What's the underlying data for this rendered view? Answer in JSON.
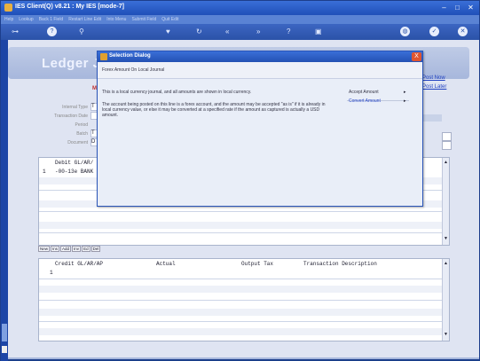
{
  "window": {
    "title": "IES Client(Q) v8.21 : My IES      [mode-7]",
    "buttons": {
      "min": "–",
      "max": "□",
      "close": "✕"
    }
  },
  "menu": [
    "Help",
    "Lookup",
    "Back 1 Field",
    "Restart Line Edit",
    "Into Menu",
    "Submit Field",
    "Quit Edit"
  ],
  "toolbar": {
    "items": [
      {
        "icon": "key-icon",
        "glyph": "⊶"
      },
      {
        "icon": "help-icon",
        "glyph": "?"
      },
      {
        "icon": "search-icon",
        "glyph": "⚲"
      },
      {
        "icon": "heart-icon",
        "glyph": "♥"
      },
      {
        "icon": "refresh-icon",
        "glyph": "↻"
      },
      {
        "icon": "rewind-icon",
        "glyph": "«"
      },
      {
        "icon": "forward-icon",
        "glyph": "»"
      },
      {
        "icon": "question-icon",
        "glyph": "?"
      },
      {
        "icon": "printer-icon",
        "glyph": "▣"
      },
      {
        "icon": "globe-icon",
        "glyph": "◍"
      },
      {
        "icon": "check-icon",
        "glyph": "✓"
      },
      {
        "icon": "cancel-icon",
        "glyph": "✕"
      }
    ]
  },
  "page": {
    "title": "Ledger Jo",
    "links": [
      "Post Now",
      "Post Later"
    ]
  },
  "form": {
    "labels": [
      "Internal Type",
      "Transaction Date",
      "Period",
      "Batch",
      "Document"
    ],
    "inputs": [
      "T",
      "",
      "",
      "T",
      "D"
    ]
  },
  "debit_grid": {
    "header": "Debit GL/AR/",
    "rows": [
      {
        "num": "1",
        "text": "-00-13e BANK"
      }
    ]
  },
  "tabs": [
    "New",
    "Ins",
    "Add",
    "Inv",
    "Ed",
    "Del"
  ],
  "credit_grid": {
    "headers": [
      "Credit GL/AR/AP",
      "Actual",
      "Output Tax",
      "Transaction Description"
    ],
    "rows": [
      {
        "num": "1"
      }
    ]
  },
  "dialog": {
    "title": "Selection Dialog",
    "close": "X",
    "header": "Forex Amount On Local Journal",
    "para1": "This is a local currency journal, and all amounts are shown in local currency.",
    "para2": "The account being posted on this line is a forex account, and the amount may be accepted \"as is\" if it is already in local currency value, or else it may be converted at a specified rate if the amount as captured is actually a USD amount.",
    "options": [
      {
        "label": "Accept Amount",
        "arrow": "▸"
      },
      {
        "label": "Convert Amount",
        "arrow": "▸"
      }
    ]
  },
  "scroll": {
    "up": "▲",
    "down": "▼"
  }
}
